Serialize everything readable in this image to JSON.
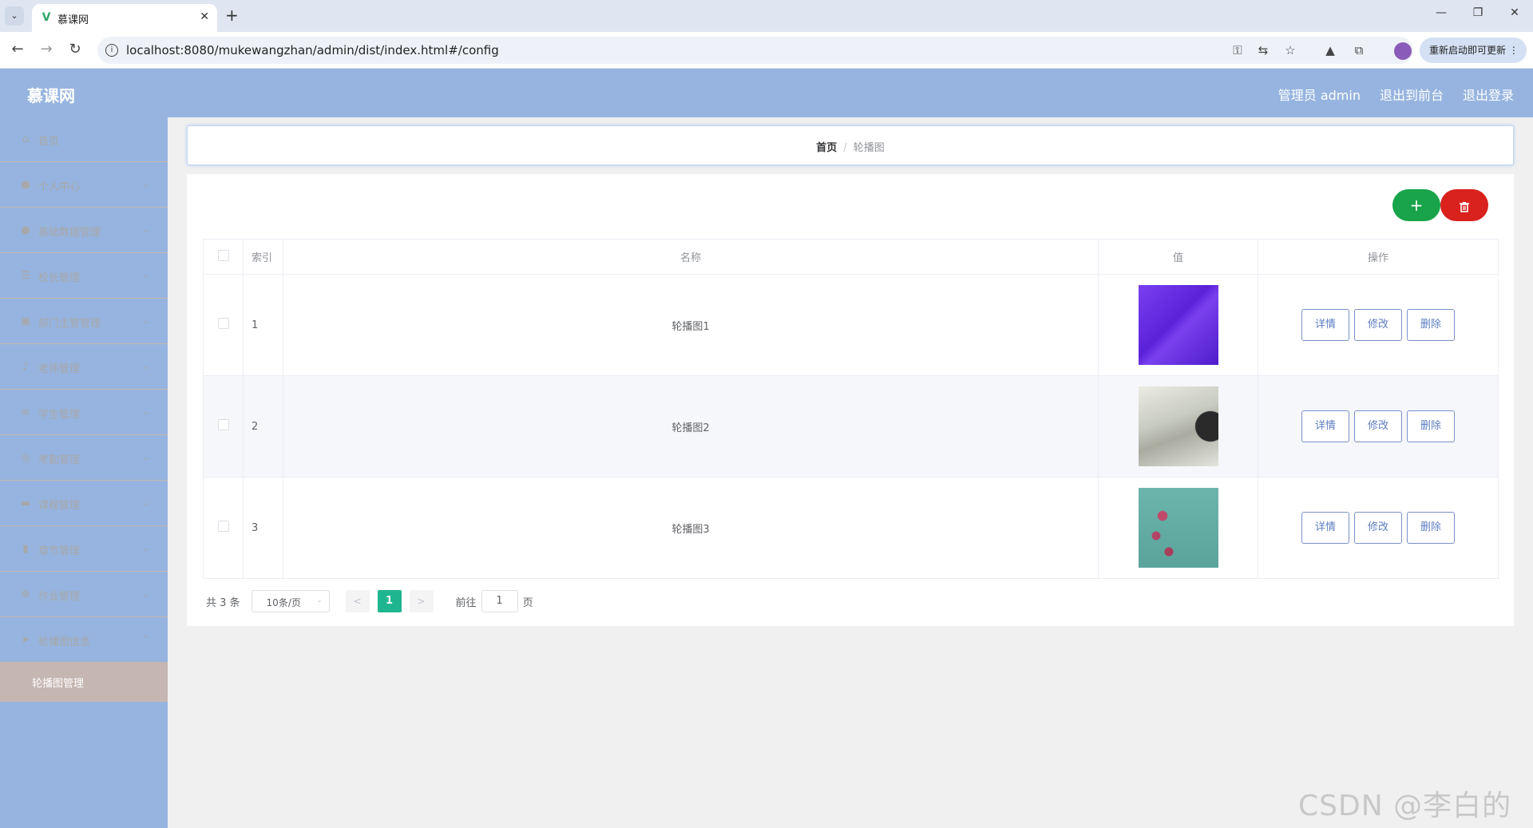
{
  "browser": {
    "tab_title": "慕课网",
    "url": "localhost:8080/mukewangzhan/admin/dist/index.html#/config",
    "update_button": "重新启动即可更新"
  },
  "app": {
    "logo": "慕课网",
    "header_links": [
      "管理员 admin",
      "退出到前台",
      "退出登录"
    ]
  },
  "sidebar": {
    "items": [
      {
        "label": "首页",
        "icon": "home-icon"
      },
      {
        "label": "个人中心",
        "icon": "user-icon"
      },
      {
        "label": "基础数据管理",
        "icon": "user-icon"
      },
      {
        "label": "校长管理",
        "icon": "sliders-icon"
      },
      {
        "label": "部门主管管理",
        "icon": "clipboard-icon"
      },
      {
        "label": "老师管理",
        "icon": "microphone-icon"
      },
      {
        "label": "学生管理",
        "icon": "list-icon"
      },
      {
        "label": "考勤管理",
        "icon": "target-icon"
      },
      {
        "label": "课程管理",
        "icon": "chat-icon"
      },
      {
        "label": "章节管理",
        "icon": "book-icon"
      },
      {
        "label": "作业管理",
        "icon": "compass-icon"
      },
      {
        "label": "轮播图信息",
        "icon": "send-icon"
      }
    ],
    "sub_item": "轮播图管理"
  },
  "breadcrumb": {
    "home": "首页",
    "separator": "/",
    "current": "轮播图"
  },
  "actions": {
    "add": "+",
    "delete": "🗑"
  },
  "table": {
    "headers": [
      "索引",
      "名称",
      "值",
      "操作"
    ],
    "rows": [
      {
        "index": "1",
        "name": "轮播图1",
        "image_color": "#6a2fe6"
      },
      {
        "index": "2",
        "name": "轮播图2",
        "image_color": "#d9dcd2"
      },
      {
        "index": "3",
        "name": "轮播图3",
        "image_color": "#5fa9a0"
      }
    ],
    "row_buttons": [
      "详情",
      "修改",
      "删除"
    ]
  },
  "pagination": {
    "total": "共 3 条",
    "page_size": "10条/页",
    "current_page": "1",
    "goto_label": "前往",
    "goto_value": "1",
    "page_suffix": "页"
  },
  "watermark": "CSDN @李白的粉",
  "colors": {
    "header": "#96b4df",
    "sidebar_active": "#c5b6b1",
    "add_button": "#19a34a",
    "delete_button": "#d9211d",
    "pager_active": "#1fb58f"
  }
}
